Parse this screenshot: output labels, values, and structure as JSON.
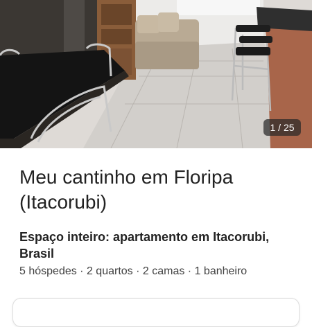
{
  "listing": {
    "photo": {
      "icon": "listing-photo",
      "counter": "1 / 25"
    },
    "title": "Meu cantinho em Floripa (Itacorubi)",
    "subtitle": "Espaço inteiro: apartamento em Itacorubi, Brasil",
    "details": "5 hóspedes · 2 quartos · 2 camas · 1 banheiro"
  },
  "colors": {
    "text": "#222222",
    "secondary_text": "#404040",
    "counter_bg": "#282828",
    "card_border": "#dddddd"
  }
}
